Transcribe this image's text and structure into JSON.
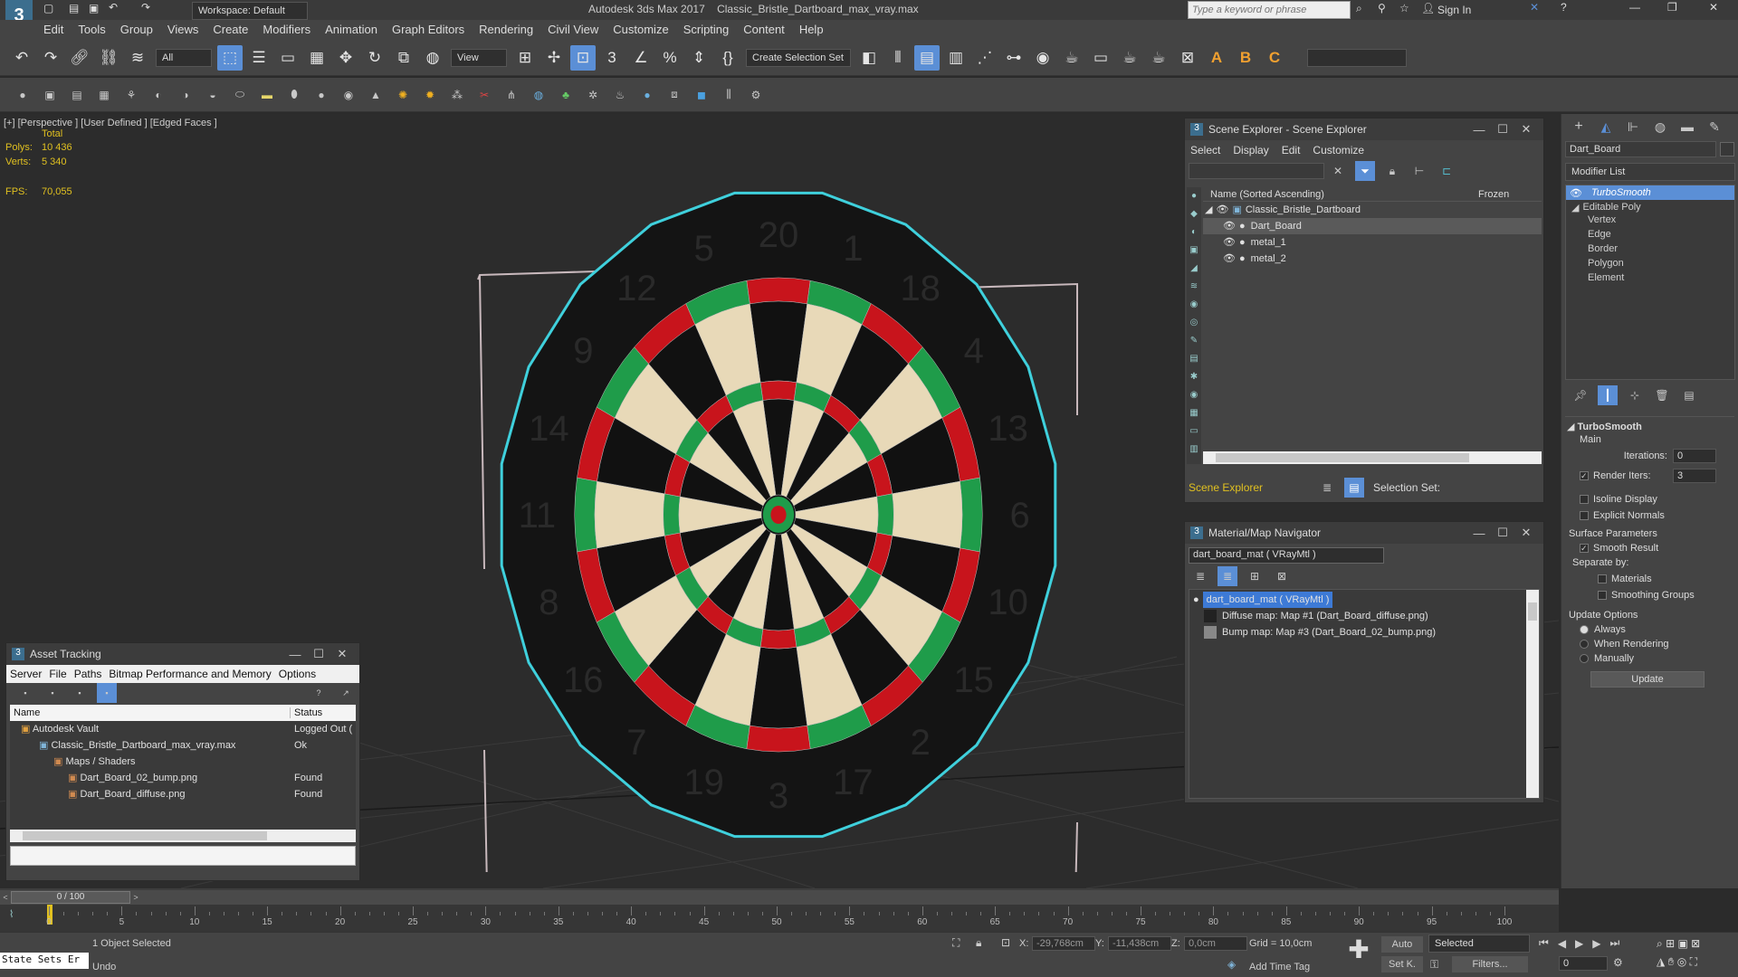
{
  "titlebar": {
    "app": "Autodesk 3ds Max 2017",
    "file": "Classic_Bristle_Dartboard_max_vray.max",
    "workspace": "Workspace: Default",
    "search_placeholder": "Type a keyword or phrase",
    "sign_in": "Sign In"
  },
  "menu": [
    "Edit",
    "Tools",
    "Group",
    "Views",
    "Create",
    "Modifiers",
    "Animation",
    "Graph Editors",
    "Rendering",
    "Civil View",
    "Customize",
    "Scripting",
    "Content",
    "Help"
  ],
  "toolbar": {
    "filter": "All",
    "refcoord": "View",
    "selection_set": "Create Selection Set"
  },
  "viewport": {
    "label": "[+] [Perspective ] [User Defined ] [Edged Faces ]",
    "total": "Total",
    "polys_label": "Polys:",
    "polys": "10 436",
    "verts_label": "Verts:",
    "verts": "5 340",
    "fps_label": "FPS:",
    "fps": "70,055"
  },
  "dartboard": {
    "numbers": [
      "20",
      "1",
      "18",
      "4",
      "13",
      "6",
      "10",
      "15",
      "2",
      "17",
      "3",
      "19",
      "7",
      "16",
      "8",
      "11",
      "14",
      "9",
      "12",
      "5"
    ]
  },
  "scene_explorer": {
    "title": "Scene Explorer - Scene Explorer",
    "menu": [
      "Select",
      "Display",
      "Edit",
      "Customize"
    ],
    "col_name": "Name (Sorted Ascending)",
    "col_frozen": "Frozen",
    "root": "Classic_Bristle_Dartboard",
    "items": [
      "Dart_Board",
      "metal_1",
      "metal_2"
    ],
    "footer_label": "Scene Explorer",
    "selection_set": "Selection Set:"
  },
  "mat_nav": {
    "title": "Material/Map Navigator",
    "field": "dart_board_mat  ( VRayMtl )",
    "root": "dart_board_mat  ( VRayMtl )",
    "items": [
      "Diffuse map: Map #1 (Dart_Board_diffuse.png)",
      "Bump map: Map #3 (Dart_Board_02_bump.png)"
    ]
  },
  "asset_tracking": {
    "title": "Asset Tracking",
    "menu": [
      "Server",
      "File",
      "Paths",
      "Bitmap Performance and Memory",
      "Options"
    ],
    "col_name": "Name",
    "col_status": "Status",
    "rows": [
      {
        "name": "Autodesk Vault",
        "status": "Logged Out ("
      },
      {
        "name": "Classic_Bristle_Dartboard_max_vray.max",
        "status": "Ok"
      },
      {
        "name": "Maps / Shaders",
        "status": ""
      },
      {
        "name": "Dart_Board_02_bump.png",
        "status": "Found"
      },
      {
        "name": "Dart_Board_diffuse.png",
        "status": "Found"
      }
    ]
  },
  "cmdpanel": {
    "object_name": "Dart_Board",
    "modifier_list": "Modifier List",
    "stack": [
      "TurboSmooth",
      "Editable Poly",
      "Vertex",
      "Edge",
      "Border",
      "Polygon",
      "Element"
    ],
    "rollout": "TurboSmooth",
    "main": "Main",
    "iterations_label": "Iterations:",
    "iterations": "0",
    "render_iters_label": "Render Iters:",
    "render_iters": "3",
    "isoline": "Isoline Display",
    "explicit": "Explicit Normals",
    "surface": "Surface Parameters",
    "smooth_result": "Smooth Result",
    "separate": "Separate by:",
    "materials": "Materials",
    "smoothing": "Smoothing Groups",
    "update_options": "Update Options",
    "always": "Always",
    "when_rendering": "When Rendering",
    "manually": "Manually",
    "update_btn": "Update"
  },
  "timeline": {
    "frame": "0 / 100",
    "ticks": [
      "0",
      "5",
      "10",
      "15",
      "20",
      "25",
      "30",
      "35",
      "40",
      "45",
      "50",
      "55",
      "60",
      "65",
      "70",
      "75",
      "80",
      "85",
      "90",
      "95",
      "100"
    ]
  },
  "status": {
    "maxscript": "State Sets Er",
    "selected": "1 Object Selected",
    "undo": "Undo",
    "x_label": "X:",
    "x": "-29,768cm",
    "y_label": "Y:",
    "y": "-11,438cm",
    "z_label": "Z:",
    "z": "0,0cm",
    "grid": "Grid = 10,0cm",
    "add_time_tag": "Add Time Tag",
    "auto": "Auto",
    "selected_dd": "Selected",
    "setk": "Set K.",
    "filters": "Filters...",
    "frame_spin": "0"
  },
  "colors": {
    "accent": "#5b8fd6",
    "selection_outline": "#3fd0dc",
    "board_red": "#c8141c",
    "board_green": "#1f9c4a",
    "board_cream": "#e8d9b8"
  }
}
